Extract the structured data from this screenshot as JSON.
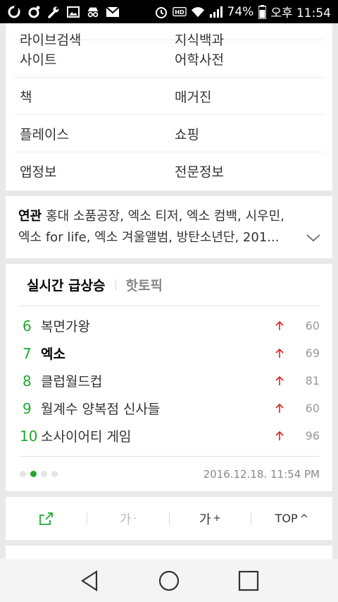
{
  "status_bar": {
    "battery": "74%",
    "time": "오후 11:54",
    "icons": [
      "circle-g-icon",
      "circle-o-icon",
      "wrench-icon",
      "image-icon",
      "incognito-icon",
      "mail-icon",
      "alarm-icon",
      "hd-icon",
      "wifi-icon",
      "signal-icon",
      "battery-icon"
    ]
  },
  "categories": {
    "partial_row": [
      "라이브검색",
      "지식백과"
    ],
    "rows": [
      [
        "사이트",
        "어학사전"
      ],
      [
        "책",
        "매거진"
      ],
      [
        "플레이스",
        "쇼핑"
      ],
      [
        "앱정보",
        "전문정보"
      ]
    ]
  },
  "related": {
    "label": "연관",
    "text": "홍대 소품공장, 엑소 티저, 엑소 컴백, 시우민, 엑소 for life, 엑소 겨울앨범, 방탄소년단, 201..."
  },
  "trending": {
    "tab_active": "실시간 급상승",
    "tab_inactive": "핫토픽",
    "items": [
      {
        "rank": "6",
        "keyword": "복면가왕",
        "count": "60",
        "bold": false
      },
      {
        "rank": "7",
        "keyword": "엑소",
        "count": "69",
        "bold": true
      },
      {
        "rank": "8",
        "keyword": "클럽월드컵",
        "count": "81",
        "bold": false
      },
      {
        "rank": "9",
        "keyword": "월계수 양복점 신사들",
        "count": "60",
        "bold": false
      },
      {
        "rank": "10",
        "keyword": "소사이어티 게임",
        "count": "96",
        "bold": false
      }
    ],
    "timestamp": "2016.12.18. 11:54 PM",
    "page_dots": 4,
    "active_dot": 1,
    "accent": "#1faa2e",
    "up_color": "#e02020"
  },
  "toolbar": {
    "font_down": "가",
    "font_down_sign": "-",
    "font_up": "가",
    "font_up_sign": "+",
    "top": "TOP",
    "top_caret": "^"
  }
}
